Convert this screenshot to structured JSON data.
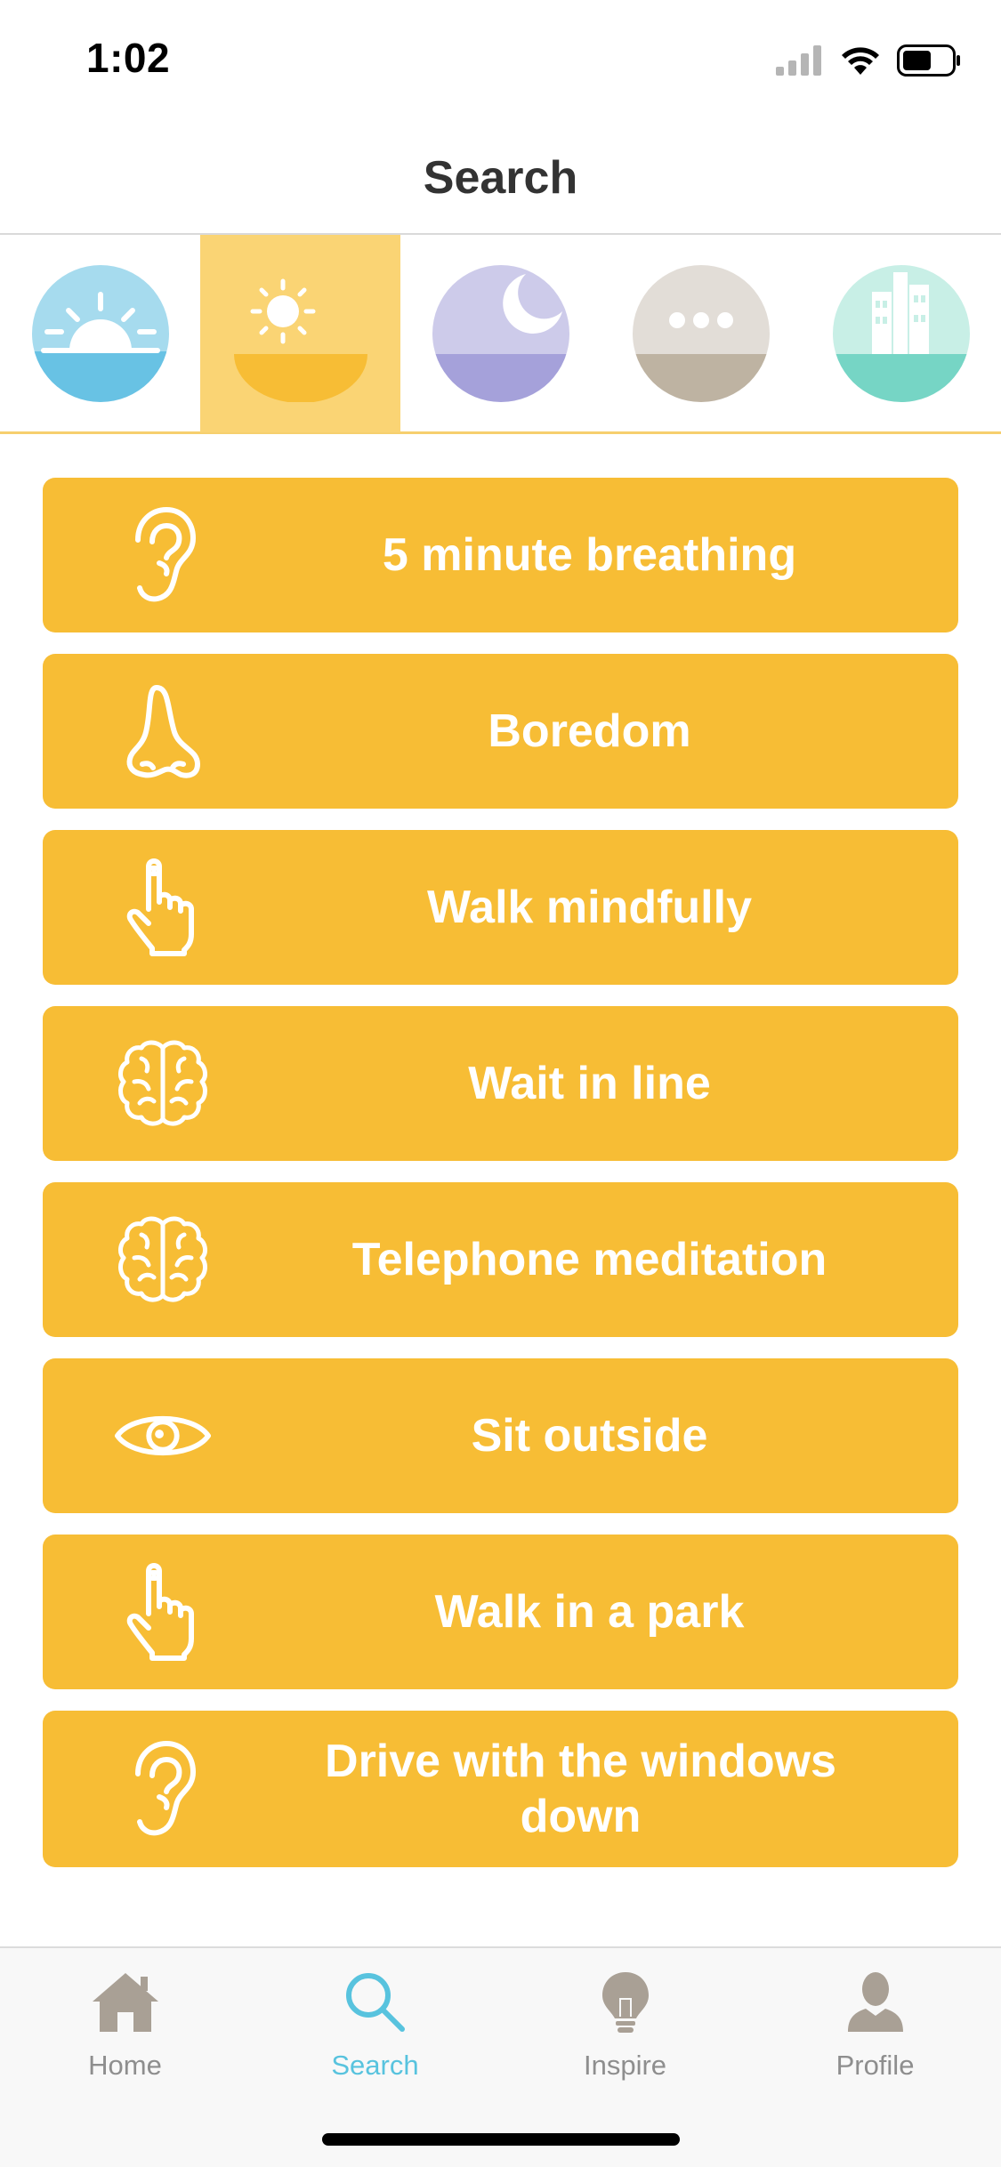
{
  "status_bar": {
    "time": "1:02",
    "icons": [
      "cellular-signal-icon",
      "wifi-icon",
      "battery-icon"
    ]
  },
  "header": {
    "title": "Search"
  },
  "categories": [
    {
      "name": "sunrise-icon",
      "selected": false,
      "top_color": "#a6dbee",
      "bottom_color": "#68c2e4"
    },
    {
      "name": "sun-icon",
      "selected": true,
      "top_color": "#fad474",
      "bottom_color": "#f7bd35"
    },
    {
      "name": "moon-icon",
      "selected": false,
      "top_color": "#cdcbea",
      "bottom_color": "#a5a1da"
    },
    {
      "name": "more-icon",
      "selected": false,
      "top_color": "#e2ddd7",
      "bottom_color": "#beb3a2"
    },
    {
      "name": "city-icon",
      "selected": false,
      "top_color": "#c8efe6",
      "bottom_color": "#76d5c5"
    }
  ],
  "activities": [
    {
      "label": "5 minute breathing",
      "icon": "ear-icon"
    },
    {
      "label": "Boredom",
      "icon": "nose-icon"
    },
    {
      "label": "Walk mindfully",
      "icon": "hand-pointer-icon"
    },
    {
      "label": "Wait in line",
      "icon": "brain-icon"
    },
    {
      "label": "Telephone meditation",
      "icon": "brain-icon"
    },
    {
      "label": "Sit outside",
      "icon": "eye-icon"
    },
    {
      "label": "Walk in a park",
      "icon": "hand-pointer-icon"
    },
    {
      "label": "Drive with the windows down",
      "icon": "ear-icon"
    }
  ],
  "tab_bar": {
    "tabs": [
      {
        "label": "Home",
        "icon": "home-icon",
        "active": false
      },
      {
        "label": "Search",
        "icon": "search-icon",
        "active": true
      },
      {
        "label": "Inspire",
        "icon": "lightbulb-icon",
        "active": false
      },
      {
        "label": "Profile",
        "icon": "profile-icon",
        "active": false
      }
    ]
  },
  "colors": {
    "accent": "#f7bd35",
    "selected_tab": "#58c3de",
    "inactive_tab": "#8e8e8e"
  }
}
